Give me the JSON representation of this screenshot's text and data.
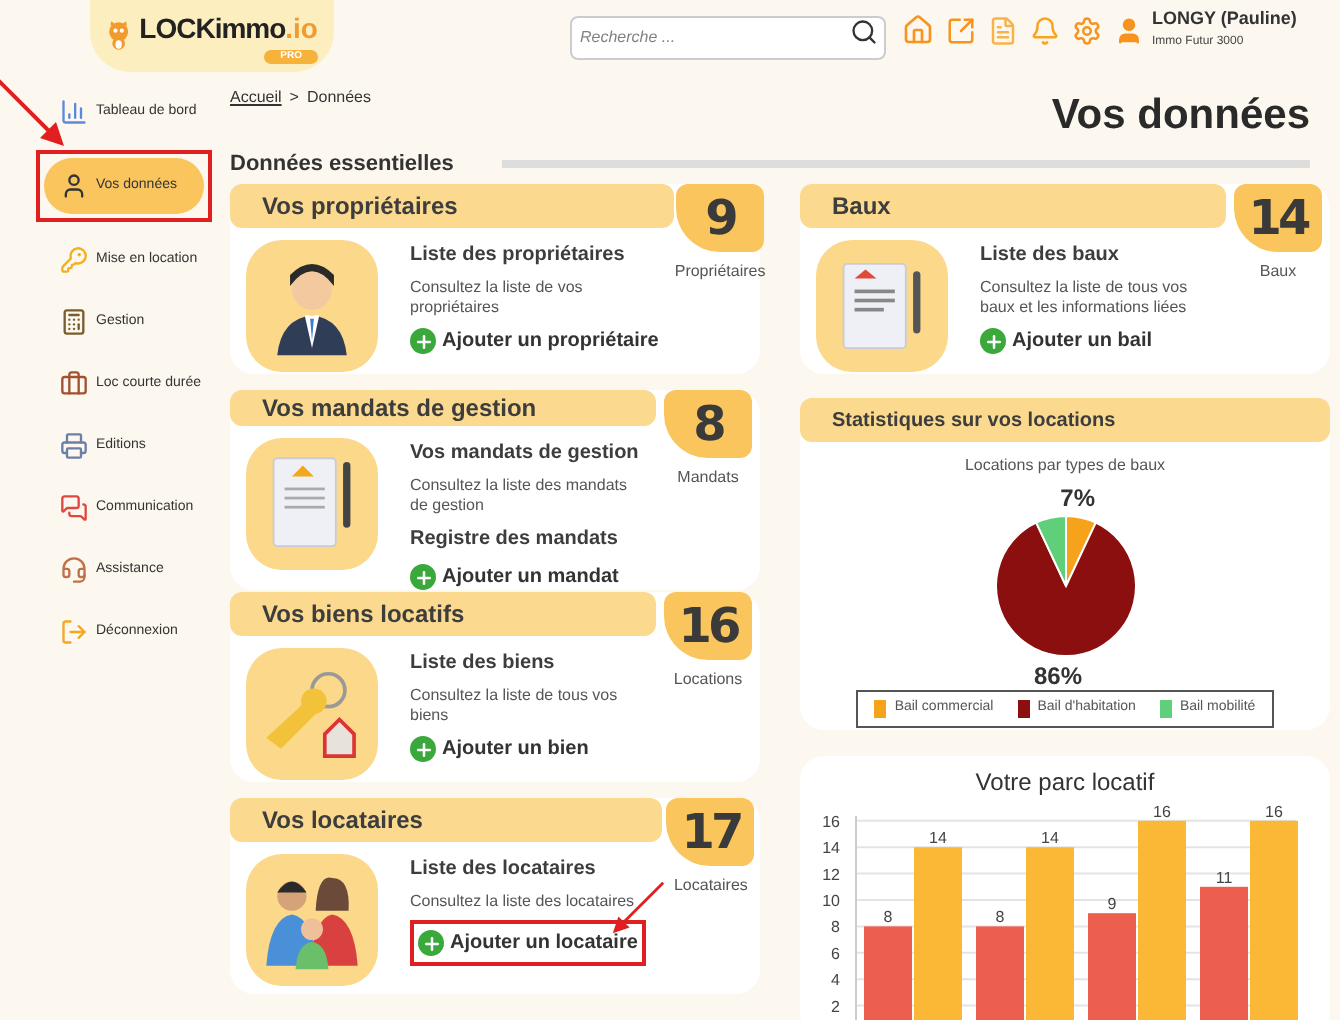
{
  "logo": {
    "name": "LOCKimmo",
    "suffix": ".io",
    "badge": "PRO"
  },
  "search": {
    "placeholder": "Recherche ..."
  },
  "user": {
    "name": "LONGY (Pauline)",
    "company": "Immo Futur 3000"
  },
  "sidebar": {
    "items": [
      {
        "label": "Tableau de bord",
        "selected": false,
        "highlighted": false
      },
      {
        "label": "Vos données",
        "selected": true,
        "highlighted": true
      },
      {
        "label": "Mise en location",
        "selected": false,
        "highlighted": false
      },
      {
        "label": "Gestion",
        "selected": false,
        "highlighted": false
      },
      {
        "label": "Loc courte durée",
        "selected": false,
        "highlighted": false
      },
      {
        "label": "Editions",
        "selected": false,
        "highlighted": false
      },
      {
        "label": "Communication",
        "selected": false,
        "highlighted": false
      },
      {
        "label": "Assistance",
        "selected": false,
        "highlighted": false
      },
      {
        "label": "Déconnexion",
        "selected": false,
        "highlighted": false
      }
    ]
  },
  "breadcrumb": [
    {
      "kind": "link",
      "text": "Accueil"
    },
    {
      "kind": "separator",
      "text": ">"
    },
    {
      "kind": "current",
      "text": "Données"
    }
  ],
  "page_title": "Vos données",
  "section_title": "Données essentielles",
  "left_cards": [
    {
      "title": "Vos propriétaires",
      "count": "9",
      "count_label": "Propriétaires",
      "lines": [
        {
          "kind": "heading",
          "text": "Liste des propriétaires"
        },
        {
          "kind": "text",
          "text": "Consultez la liste de vos propriétaires"
        },
        {
          "kind": "add",
          "text": "Ajouter un propriétaire",
          "highlighted": false
        }
      ]
    },
    {
      "title": "Vos mandats de gestion",
      "count": "8",
      "count_label": "Mandats",
      "lines": [
        {
          "kind": "heading",
          "text": "Vos mandats de gestion"
        },
        {
          "kind": "text",
          "text": "Consultez la liste des mandats de gestion"
        },
        {
          "kind": "heading",
          "text": "Registre des mandats"
        },
        {
          "kind": "add",
          "text": "Ajouter un mandat",
          "highlighted": false
        }
      ]
    },
    {
      "title": "Vos biens locatifs",
      "count": "16",
      "count_label": "Locations",
      "lines": [
        {
          "kind": "heading",
          "text": "Liste des biens"
        },
        {
          "kind": "text",
          "text": "Consultez la liste de tous vos biens"
        },
        {
          "kind": "add",
          "text": "Ajouter un bien",
          "highlighted": false
        }
      ]
    },
    {
      "title": "Vos locataires",
      "count": "17",
      "count_label": "Locataires",
      "lines": [
        {
          "kind": "heading",
          "text": "Liste des locataires"
        },
        {
          "kind": "text",
          "text": "Consultez la liste des locataires"
        },
        {
          "kind": "add",
          "text": "Ajouter un locataire",
          "highlighted": true
        }
      ]
    }
  ],
  "leases_card": {
    "title": "Baux",
    "count": "14",
    "count_label": "Baux",
    "lines": [
      {
        "kind": "heading",
        "text": "Liste des baux"
      },
      {
        "kind": "text",
        "text": "Consultez la liste de tous vos baux et les informations liées"
      },
      {
        "kind": "add",
        "text": "Ajouter un bail",
        "highlighted": false
      }
    ]
  },
  "stats_card": {
    "title": "Statistiques sur vos locations",
    "chart_data": {
      "type": "pie",
      "title": "Locations par types de baux",
      "categories": [
        "Bail commercial",
        "Bail d'habitation",
        "Bail mobilité"
      ],
      "series": [
        {
          "values": [
            7,
            86,
            7
          ]
        }
      ],
      "colors": [
        "#f7a21b",
        "#8b0f0f",
        "#5fcf7a"
      ],
      "value_labels": [
        "7%",
        "86%",
        null
      ]
    }
  },
  "fleet_chart": {
    "chart_data": {
      "type": "bar",
      "title": "Votre parc locatif",
      "series": [
        {
          "color": "#ec5f4f",
          "values": [
            8,
            8,
            9,
            11
          ]
        },
        {
          "color": "#fbb836",
          "values": [
            14,
            14,
            16,
            16
          ]
        }
      ],
      "ylim": [
        0,
        16
      ],
      "grid": true,
      "yticks": [
        2,
        4,
        6,
        8,
        10,
        12,
        14,
        16
      ],
      "data_labels": true
    }
  }
}
